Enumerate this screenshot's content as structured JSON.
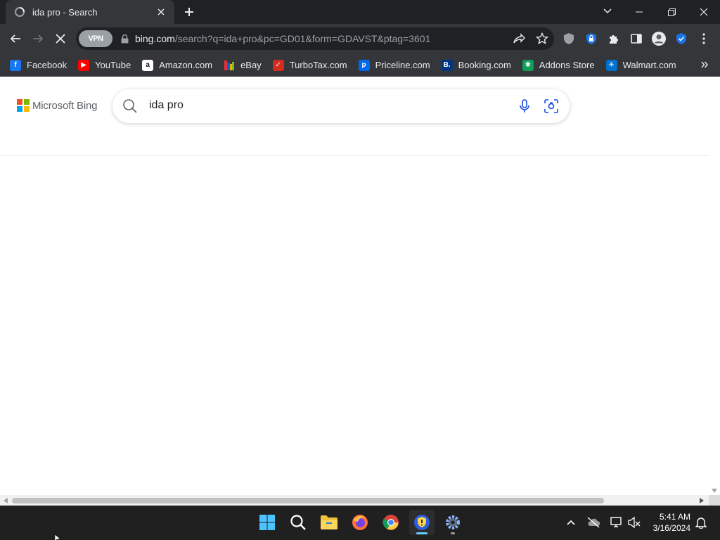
{
  "browser": {
    "tab": {
      "title": "ida pro - Search"
    },
    "omnibox": {
      "vpn_label": "VPN",
      "url_host": "bing.com",
      "url_rest": "/search?q=ida+pro&pc=GD01&form=GDAVST&ptag=3601"
    },
    "bookmarks": [
      {
        "label": "Facebook",
        "icon": "facebook-icon",
        "color": "#1877f2",
        "glyph": "f"
      },
      {
        "label": "YouTube",
        "icon": "youtube-icon",
        "color": "#ff0000",
        "glyph": "▶"
      },
      {
        "label": "Amazon.com",
        "icon": "amazon-icon",
        "color": "#ffffff",
        "glyph": "a"
      },
      {
        "label": "eBay",
        "icon": "ebay-icon",
        "color": "#35363a",
        "glyph": ""
      },
      {
        "label": "TurboTax.com",
        "icon": "turbotax-icon",
        "color": "#d52b1e",
        "glyph": "✓"
      },
      {
        "label": "Priceline.com",
        "icon": "priceline-icon",
        "color": "#0068ef",
        "glyph": "p"
      },
      {
        "label": "Booking.com",
        "icon": "booking-icon",
        "color": "#003580",
        "glyph": "B."
      },
      {
        "label": "Addons Store",
        "icon": "addons-store-icon",
        "color": "#0f9d58",
        "glyph": "✱"
      },
      {
        "label": "Walmart.com",
        "icon": "walmart-icon",
        "color": "#0071ce",
        "glyph": "✳"
      }
    ]
  },
  "bing": {
    "logo_text": "Microsoft Bing",
    "query": "ida pro"
  },
  "taskbar": {
    "time": "5:41 AM",
    "date": "3/16/2024"
  },
  "colors": {
    "chrome_dark": "#202124",
    "chrome_toolbar": "#35363a",
    "bing_accent": "#174ae4",
    "taskbar_bg": "#202020",
    "active_indicator": "#60cdff"
  }
}
